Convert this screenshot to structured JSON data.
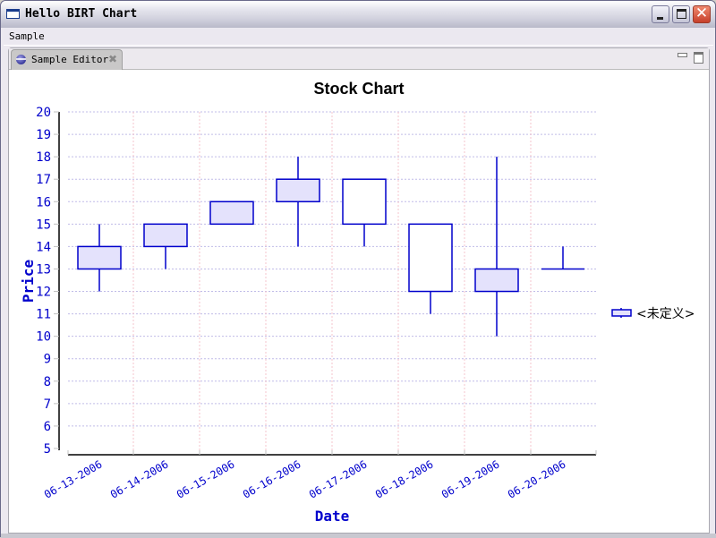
{
  "window": {
    "title": "Hello BIRT Chart",
    "buttons": [
      "minimize",
      "maximize",
      "close"
    ]
  },
  "menu": {
    "items": [
      {
        "label": "Sample"
      }
    ]
  },
  "editor": {
    "tab_label": "Sample Editor",
    "tab_icon": "eclipse-icon",
    "view_controls": [
      "minimize",
      "maximize"
    ]
  },
  "chart_data": {
    "type": "stock",
    "title": "Stock Chart",
    "xlabel": "Date",
    "ylabel": "Price",
    "ylim": [
      5,
      20
    ],
    "ytick_step": 1,
    "yticks": [
      "5",
      "6",
      "7",
      "8",
      "9",
      "10",
      "11",
      "12",
      "13",
      "14",
      "15",
      "16",
      "17",
      "18",
      "19",
      "20"
    ],
    "grid": true,
    "legend": {
      "position": "right",
      "entries": [
        "<未定义>"
      ]
    },
    "categories": [
      "06-13-2006",
      "06-14-2006",
      "06-15-2006",
      "06-16-2006",
      "06-17-2006",
      "06-18-2006",
      "06-19-2006",
      "06-20-2006"
    ],
    "series": [
      {
        "name": "<未定义>",
        "points": [
          {
            "date": "06-13-2006",
            "open": 13,
            "close": 14,
            "high": 15,
            "low": 12
          },
          {
            "date": "06-14-2006",
            "open": 14,
            "close": 15,
            "high": 15,
            "low": 13
          },
          {
            "date": "06-15-2006",
            "open": 15,
            "close": 16,
            "high": 16,
            "low": 15
          },
          {
            "date": "06-16-2006",
            "open": 16,
            "close": 17,
            "high": 18,
            "low": 14
          },
          {
            "date": "06-17-2006",
            "open": 17,
            "close": 15,
            "high": 17,
            "low": 14
          },
          {
            "date": "06-18-2006",
            "open": 15,
            "close": 12,
            "high": 15,
            "low": 11
          },
          {
            "date": "06-19-2006",
            "open": 12,
            "close": 13,
            "high": 18,
            "low": 10
          },
          {
            "date": "06-20-2006",
            "open": 13,
            "close": 13,
            "high": 14,
            "low": 13
          }
        ]
      }
    ],
    "colors": {
      "series_line": "#0000cc",
      "rising_fill": "#e4e2fc",
      "falling_fill": "#ffffff",
      "y_grid": "#c0bce8",
      "x_grid": "#f4c4cc",
      "axis_text": "#0000cc",
      "title_text": "#000000"
    }
  }
}
